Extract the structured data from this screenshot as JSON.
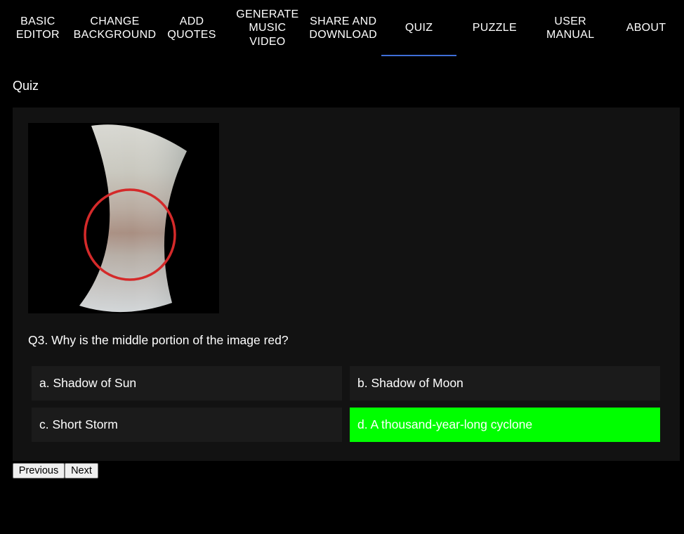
{
  "nav": {
    "tabs": [
      {
        "label": "BASIC\nEDITOR",
        "active": false
      },
      {
        "label": "CHANGE\nBACKGROUND",
        "active": false
      },
      {
        "label": "ADD\nQUOTES",
        "active": false
      },
      {
        "label": "GENERATE\nMUSIC\nVIDEO",
        "active": false
      },
      {
        "label": "SHARE AND\nDOWNLOAD",
        "active": false
      },
      {
        "label": "QUIZ",
        "active": true
      },
      {
        "label": "PUZZLE",
        "active": false
      },
      {
        "label": "USER\nMANUAL",
        "active": false
      },
      {
        "label": "ABOUT",
        "active": false
      }
    ],
    "active_indicator_color": "#3f6fd8"
  },
  "page": {
    "title": "Quiz"
  },
  "quiz": {
    "image": {
      "subject": "planet-band-image",
      "highlight": "red-circle",
      "highlight_color": "#d42a2a"
    },
    "question": "Q3. Why is the middle portion of the image red?",
    "options": [
      {
        "label": "a. Shadow of Sun",
        "correct": false
      },
      {
        "label": "b. Shadow of Moon",
        "correct": false
      },
      {
        "label": "c. Short Storm",
        "correct": false
      },
      {
        "label": "d. A thousand-year-long cyclone",
        "correct": true
      }
    ],
    "correct_color": "#00ff00"
  },
  "controls": {
    "previous_label": "Previous",
    "next_label": "Next"
  }
}
